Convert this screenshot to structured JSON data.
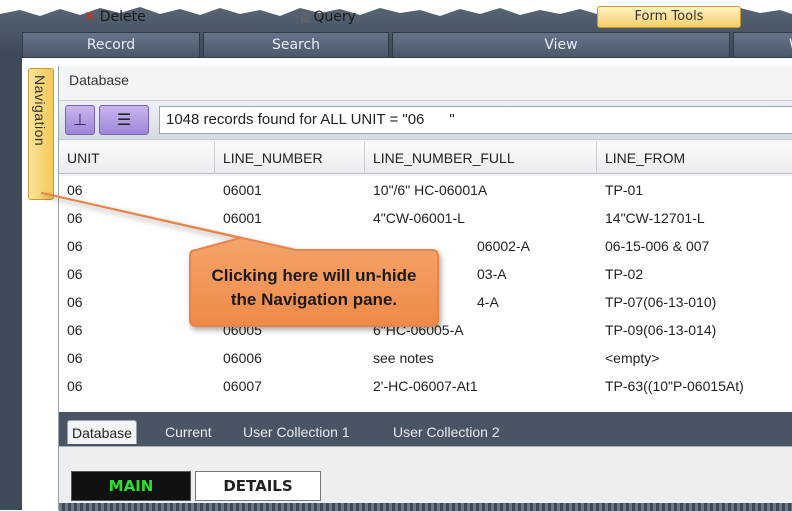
{
  "ribbon": {
    "delete_label": "Delete",
    "query_label": "Query",
    "tools_label": "Form Tools",
    "groups": [
      "Record",
      "Search",
      "View",
      "W"
    ]
  },
  "navigation": {
    "label": "Navigation"
  },
  "panel": {
    "title": "Database",
    "records_text": "1048 records found for ALL UNIT = \"06      \""
  },
  "grid": {
    "columns": [
      "UNIT",
      "LINE_NUMBER",
      "LINE_NUMBER_FULL",
      "LINE_FROM"
    ],
    "rows": [
      [
        "06",
        "06001",
        "10\"/6\" HC-06001A",
        "TP-01"
      ],
      [
        "06",
        "06001",
        "4\"CW-06001-L",
        "14\"CW-12701-L"
      ],
      [
        "06",
        "",
        "06002-A",
        "06-15-006 & 007"
      ],
      [
        "06",
        "",
        "03-A",
        "TP-02"
      ],
      [
        "06",
        "",
        "4-A",
        "TP-07(06-13-010)"
      ],
      [
        "06",
        "06005",
        "6\"HC-06005-A",
        "TP-09(06-13-014)"
      ],
      [
        "06",
        "06006",
        "see notes",
        "<empty>"
      ],
      [
        "06",
        "06007",
        "2'-HC-06007-At1",
        "TP-63((10\"P-06015At)"
      ]
    ]
  },
  "view_tabs": [
    "Database",
    "Current",
    "User Collection 1",
    "User Collection 2"
  ],
  "detail_tabs": {
    "main": "MAIN",
    "details": "DETAILS"
  },
  "callout": {
    "line1": "Clicking here will un-hide",
    "line2": "the Navigation pane."
  },
  "colors": {
    "callout_fill": "#f39a5a",
    "callout_border": "#e8834a",
    "main_tab_text": "#2ee02e"
  }
}
